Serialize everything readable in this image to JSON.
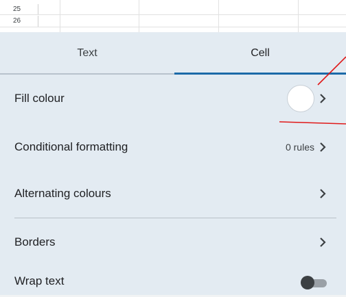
{
  "sheet": {
    "rows": [
      "25",
      "26"
    ]
  },
  "tabs": [
    {
      "label": "Text",
      "selected": false
    },
    {
      "label": "Cell",
      "selected": true
    }
  ],
  "rows": {
    "fill": {
      "label": "Fill colour",
      "swatch_color": "#ffffff"
    },
    "conditional": {
      "label": "Conditional formatting",
      "value": "0 rules"
    },
    "alternating": {
      "label": "Alternating colours"
    },
    "borders": {
      "label": "Borders"
    },
    "wrap": {
      "label": "Wrap text",
      "toggle_on": false
    }
  },
  "colors": {
    "panel_bg": "#e3ebf2",
    "tab_indicator": "#1b6aa8",
    "annotation": "#e01818"
  },
  "icons": [
    "chevron-right-icon",
    "toggle-switch"
  ]
}
